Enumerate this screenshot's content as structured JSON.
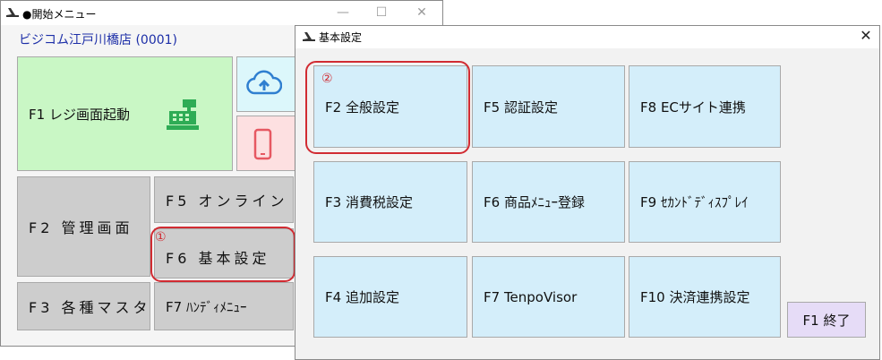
{
  "main_window": {
    "title": "●開始メニュー",
    "store_name": "ビジコム江戸川橋店 (0001)",
    "buttons": {
      "f1": "F1 レジ画面起動",
      "f2": "F2 管理画面",
      "f3": "F3 各種マスタ",
      "f5": "F5 オンライン",
      "f6": "F6 基本設定",
      "f7": "F7 ﾊﾝﾃﾞｨﾒﾆｭｰ"
    },
    "callout": "①"
  },
  "dialog": {
    "title": "基本設定",
    "callout": "②",
    "buttons": {
      "f2": "F2 全般設定",
      "f3": "F3 消費税設定",
      "f4": "F4 追加設定",
      "f5": "F5 認証設定",
      "f6": "F6 商品ﾒﾆｭｰ登録",
      "f7": "F7 TenpoVisor",
      "f8": "F8 ECサイト連携",
      "f9": "F9 ｾｶﾝﾄﾞﾃﾞｨｽﾌﾟﾚｲ",
      "f10": "F10 決済連携設定",
      "f1_exit": "F1 終了"
    }
  },
  "colors": {
    "highlight": "#d12b32",
    "register_button": "#c9f7c5",
    "settings_button": "#d4eefa",
    "exit_button": "#e6dcf7"
  },
  "icons": [
    "register-icon",
    "cloud-upload-icon",
    "smartphone-icon",
    "close-icon"
  ]
}
